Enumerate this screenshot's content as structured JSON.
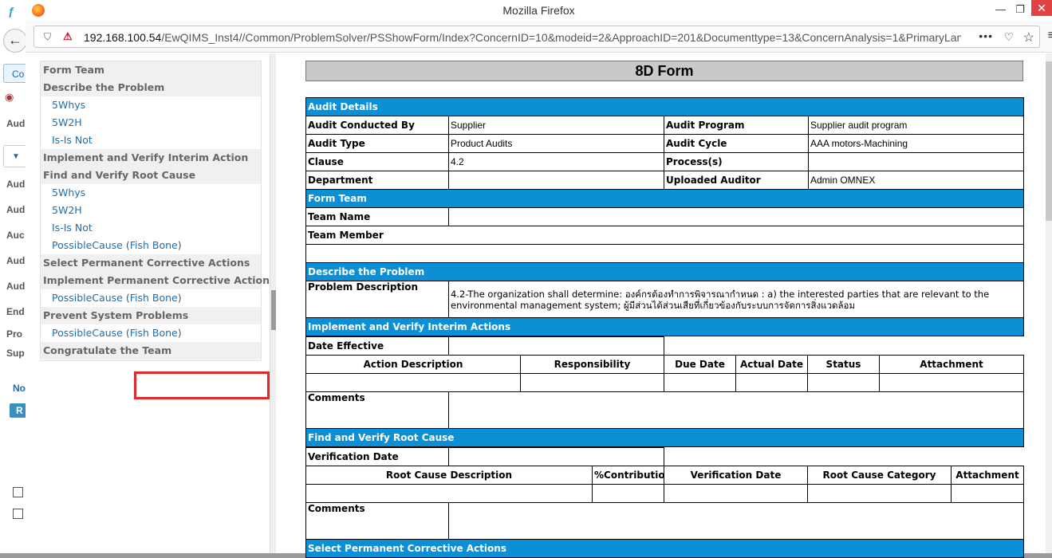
{
  "background_app": {
    "tab_label": "Co",
    "labels": [
      "Aud",
      "Aud",
      "Aud",
      "Auc",
      "Aud",
      "Aud",
      "End",
      "Pro",
      "Sup",
      "No"
    ],
    "button_label": "R"
  },
  "browser": {
    "window_title": "Mozilla Firefox",
    "url_host": "192.168.100.54",
    "url_path": "/EwQIMS_Inst4//Common/ProblemSolver/PSShowForm/Index?ConcernID=10&modeid=2&ApproachID=201&Documenttype=13&ConcernAnalysis=1&PrimaryLan",
    "page_actions": "•••"
  },
  "sidebar": {
    "items": [
      {
        "type": "section",
        "label": "Form Team"
      },
      {
        "type": "section",
        "label": "Describe the Problem"
      },
      {
        "type": "link",
        "label": "5Whys"
      },
      {
        "type": "link",
        "label": "5W2H"
      },
      {
        "type": "link",
        "label": "Is-Is Not"
      },
      {
        "type": "section",
        "label": "Implement and Verify Interim Action"
      },
      {
        "type": "section",
        "label": "Find and Verify Root Cause"
      },
      {
        "type": "link",
        "label": "5Whys"
      },
      {
        "type": "link",
        "label": "5W2H"
      },
      {
        "type": "link",
        "label": "Is-Is Not"
      },
      {
        "type": "link2",
        "label": "PossibleCause",
        "extra": "Fish Bone"
      },
      {
        "type": "section",
        "label": "Select Permanent Corrective Actions"
      },
      {
        "type": "section",
        "label": "Implement Permanent Corrective Actions"
      },
      {
        "type": "link2",
        "label": "PossibleCause",
        "extra": "Fish Bone"
      },
      {
        "type": "section",
        "label": "Prevent System Problems"
      },
      {
        "type": "link2",
        "label": "PossibleCause",
        "extra": "Fish Bone"
      },
      {
        "type": "section",
        "label": "Congratulate the Team"
      }
    ]
  },
  "form": {
    "title": "8D Form",
    "audit": {
      "header": "Audit Details",
      "conducted_by_label": "Audit Conducted By",
      "conducted_by": "Supplier",
      "program_label": "Audit Program",
      "program": "Supplier audit program",
      "type_label": "Audit Type",
      "type": "Product Audits",
      "cycle_label": "Audit Cycle",
      "cycle": "AAA motors-Machining",
      "clause_label": "Clause",
      "clause": "4.2",
      "process_label": "Process(s)",
      "process": "",
      "department_label": "Department",
      "department": "",
      "uploaded_auditor_label": "Uploaded Auditor",
      "uploaded_auditor": "Admin OMNEX"
    },
    "team": {
      "header": "Form Team",
      "name_label": "Team Name",
      "name": "",
      "member_label": "Team Member"
    },
    "problem": {
      "header": "Describe the Problem",
      "desc_label": "Problem Description",
      "desc": "4.2-The organization shall determine: องค์กรต้องทำการพิจารณากำหนด : a) the interested parties that are relevant to the environmental management system; ผู้มีส่วนได้ส่วนเสียที่เกี่ยวข้องกับระบบการจัดการสิ่งแวดล้อม"
    },
    "interim": {
      "header": "Implement and Verify Interim Actions",
      "date_label": "Date Effective",
      "cols": [
        "Action Description",
        "Responsibility",
        "Due Date",
        "Actual Date",
        "Status",
        "Attachment"
      ],
      "comments_label": "Comments"
    },
    "root_cause": {
      "header": "Find and Verify Root Cause",
      "date_label": "Verification Date",
      "cols": [
        "Root Cause Description",
        "%Contribution",
        "Verification Date",
        "Root Cause Category",
        "Attachment"
      ],
      "comments_label": "Comments"
    },
    "permanent": {
      "header": "Select Permanent Corrective Actions"
    }
  }
}
